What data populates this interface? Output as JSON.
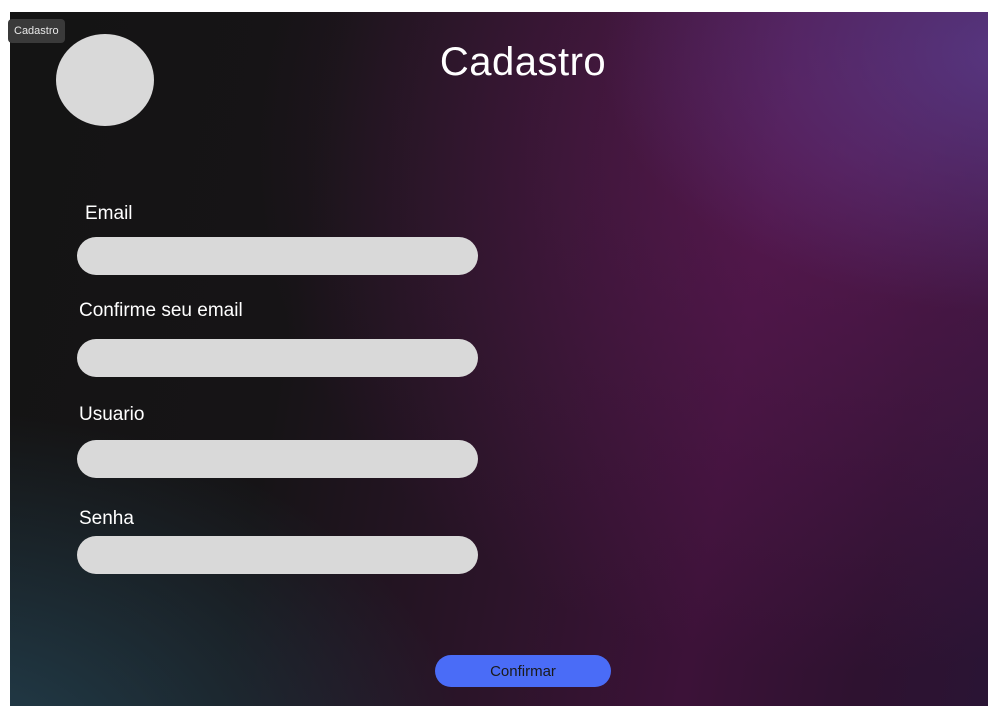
{
  "window": {
    "tag": "Cadastro"
  },
  "header": {
    "title": "Cadastro"
  },
  "form": {
    "fields": [
      {
        "label": "Email",
        "value": "",
        "placeholder": ""
      },
      {
        "label": "Confirme seu email",
        "value": "",
        "placeholder": ""
      },
      {
        "label": "Usuario",
        "value": "",
        "placeholder": ""
      },
      {
        "label": "Senha",
        "value": "",
        "placeholder": ""
      }
    ],
    "confirm_label": "Confirmar"
  },
  "colors": {
    "accent": "#4a6cf7",
    "input_fill": "#d9d9d9",
    "text": "#ffffff"
  }
}
